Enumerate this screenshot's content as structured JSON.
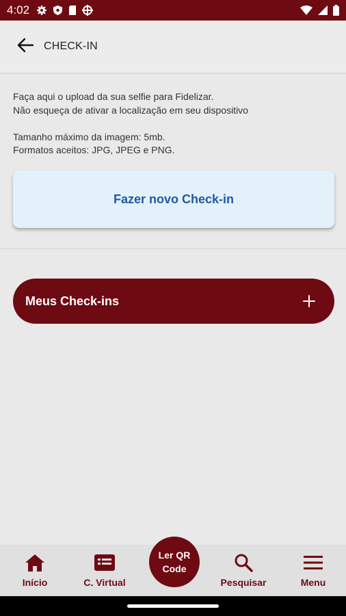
{
  "status_bar": {
    "time": "4:02",
    "icons": [
      "gear-icon",
      "shield-icon",
      "sim-card-icon",
      "crosshair-icon"
    ],
    "right_icons": [
      "wifi-icon",
      "signal-icon",
      "battery-icon"
    ]
  },
  "app_bar": {
    "back_icon": "arrow-left-icon",
    "title": "CHECK-IN"
  },
  "info": {
    "line1": "Faça aqui o upload da sua selfie para Fidelizar.",
    "line2": "Não esqueça de ativar a localização em seu dispositivo",
    "line3": "Tamanho máximo da imagem: 5mb.",
    "line4": "Formatos aceitos: JPG, JPEG e PNG."
  },
  "checkin_button": {
    "label": "Fazer novo Check-in"
  },
  "meus_checkins": {
    "label": "Meus Check-ins",
    "icon": "plus-icon"
  },
  "bottom_nav": {
    "items": [
      {
        "label": "Início",
        "icon": "home-icon"
      },
      {
        "label": "C. Virtual",
        "icon": "card-icon"
      },
      {
        "label": "Pesquisar",
        "icon": "search-icon"
      },
      {
        "label": "Menu",
        "icon": "hamburger-icon"
      }
    ],
    "qr": {
      "line1": "Ler QR",
      "line2": "Code"
    }
  },
  "colors": {
    "primary": "#6e0a12",
    "card_bg": "#e3f1fb",
    "card_text": "#2456a4",
    "background": "#e9e9e9"
  }
}
